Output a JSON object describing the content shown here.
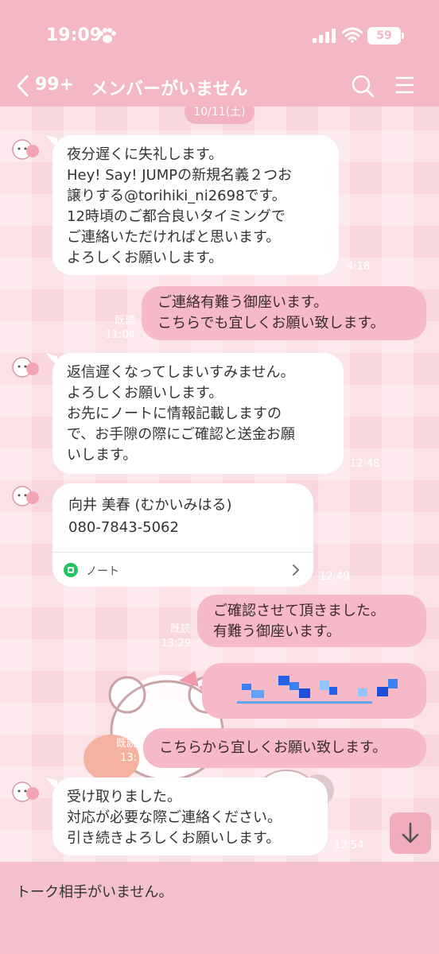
{
  "status_bar": {
    "time": "19:09",
    "battery": "59"
  },
  "header": {
    "unread_count": "99+",
    "title": "メンバーがいません"
  },
  "date_chip": "10/11(土)",
  "messages": [
    {
      "side": "in",
      "lines": [
        "夜分遅くに失礼します。",
        "Hey! Say! JUMPの新規名義２つお",
        "譲りする@torihiki_ni2698です。",
        "12時頃のご都合良いタイミングで",
        "ご連絡いただければと思います。",
        "よろしくお願いします。"
      ],
      "time": "4:18"
    },
    {
      "side": "out",
      "lines": [
        "ご連絡有難う御座います。",
        "こちらでも宜しくお願い致します。"
      ],
      "read": "既読",
      "time": "11:04"
    },
    {
      "side": "in",
      "lines": [
        "返信遅くなってしまいすみません。",
        "よろしくお願いします。",
        "お先にノートに情報記載しますの",
        "で、お手隙の際にご確認と送金お願",
        "いします。"
      ],
      "time": "12:48"
    },
    {
      "side": "in",
      "type": "note",
      "lines": [
        "向井 美春 (むかいみはる)",
        "080-7843-5062"
      ],
      "note_label": "ノート",
      "time": "12:49"
    },
    {
      "side": "out",
      "lines": [
        "ご確認させて頂きました。",
        "有難う御座います。"
      ],
      "read": "既読",
      "time": "13:29"
    },
    {
      "side": "out",
      "type": "redacted",
      "time": "13:"
    },
    {
      "side": "out",
      "lines": [
        "こちらから宜しくお願い致します。"
      ],
      "read": "既読",
      "time": "13:"
    },
    {
      "side": "in",
      "lines": [
        "受け取りました。",
        "対応が必要な際ご連絡ください。",
        "引き続きよろしくお願いします。"
      ],
      "time": "13:54"
    }
  ],
  "footer": {
    "text": "トーク相手がいません。"
  },
  "colors": {
    "header": "#f4b8c4",
    "chat_bg": "#f9d7de",
    "outgoing_bubble": "#f6b9c7",
    "incoming_bubble": "#ffffff",
    "footer": "#f4c0cb",
    "note_icon": "#22c55e"
  }
}
